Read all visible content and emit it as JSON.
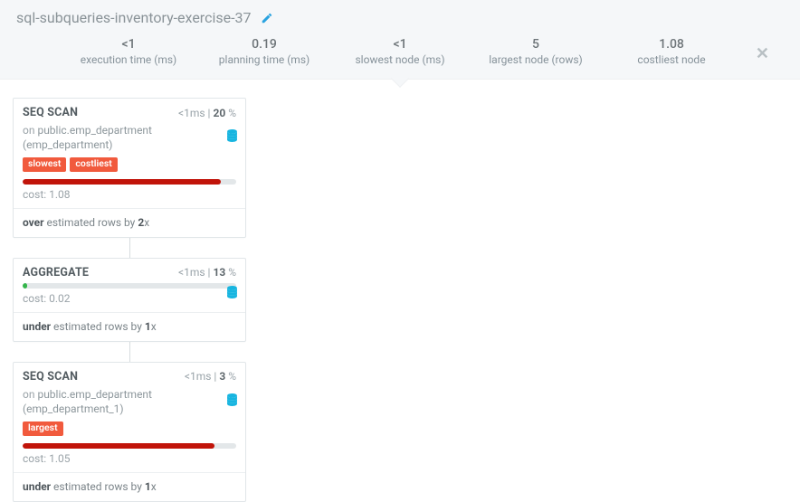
{
  "header": {
    "title": "sql-subqueries-inventory-exercise-37",
    "stats": [
      {
        "value": "<1",
        "label": "execution time (ms)"
      },
      {
        "value": "0.19",
        "label": "planning time (ms)"
      },
      {
        "value": "<1",
        "label": "slowest node (ms)"
      },
      {
        "value": "5",
        "label": "largest node (rows)"
      },
      {
        "value": "1.08",
        "label": "costliest node"
      }
    ]
  },
  "nodes": [
    {
      "title": "SEQ SCAN",
      "time": "<1",
      "time_unit": "ms",
      "pct": "20",
      "on_prefix": "on ",
      "on_body": "public.emp_department (emp_department)",
      "tags": [
        "slowest",
        "costliest"
      ],
      "bar_fill_pct": 93,
      "bar_color": "red",
      "cost_label": "cost: ",
      "cost_value": "1.08",
      "est_dir": "over",
      "est_mid": " estimated rows by ",
      "est_factor": "2",
      "est_suffix": "x",
      "db_icon_class": ""
    },
    {
      "title": "AGGREGATE",
      "time": "<1",
      "time_unit": "ms",
      "pct": "13",
      "on_prefix": "",
      "on_body": "",
      "tags": [],
      "bar_fill_pct": 2,
      "bar_color": "green",
      "cost_label": "cost: ",
      "cost_value": "0.02",
      "est_dir": "under",
      "est_mid": " estimated rows by ",
      "est_factor": "1",
      "est_suffix": "x",
      "db_icon_class": "aggpos"
    },
    {
      "title": "SEQ SCAN",
      "time": "<1",
      "time_unit": "ms",
      "pct": "3",
      "on_prefix": "on ",
      "on_body": "public.emp_department (emp_department_1)",
      "tags": [
        "largest"
      ],
      "bar_fill_pct": 90,
      "bar_color": "red",
      "cost_label": "cost: ",
      "cost_value": "1.05",
      "est_dir": "under",
      "est_mid": " estimated rows by ",
      "est_factor": "1",
      "est_suffix": "x",
      "db_icon_class": ""
    }
  ],
  "pct_suffix": " %",
  "sep": " | "
}
